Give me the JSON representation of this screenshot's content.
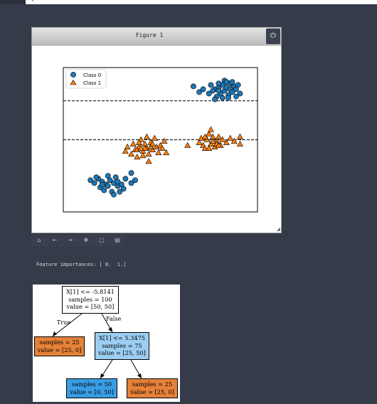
{
  "figure": {
    "title": "Figure 1",
    "power_icon": "⏻",
    "resize_icon": "◢"
  },
  "toolbar": {
    "buttons": [
      {
        "name": "home-icon",
        "glyph": "⌂"
      },
      {
        "name": "back-icon",
        "glyph": "←"
      },
      {
        "name": "forward-icon",
        "glyph": "→"
      },
      {
        "name": "pan-icon",
        "glyph": "✥"
      },
      {
        "name": "zoom-icon",
        "glyph": "▢"
      },
      {
        "name": "save-icon",
        "glyph": "▤"
      }
    ]
  },
  "output": {
    "text": "Feature importances: [ 0.  1.]"
  },
  "chart_data": {
    "type": "scatter",
    "title": "",
    "xlabel": "",
    "ylabel": "",
    "axes_ticks": "off",
    "xlim": [
      0,
      100
    ],
    "ylim": [
      0,
      100
    ],
    "grid": false,
    "legend": {
      "placement": "top-left",
      "entries": [
        "Class 0",
        "Class 1"
      ]
    },
    "series": [
      {
        "name": "Class 0",
        "marker": "circle",
        "color": "#1f77b4",
        "points": [
          [
            67,
            87
          ],
          [
            70,
            83
          ],
          [
            72,
            85
          ],
          [
            75,
            82
          ],
          [
            76,
            88
          ],
          [
            78,
            85
          ],
          [
            79,
            80
          ],
          [
            80,
            86
          ],
          [
            81,
            82
          ],
          [
            82,
            88
          ],
          [
            83,
            84
          ],
          [
            84,
            86
          ],
          [
            85,
            81
          ],
          [
            86,
            85
          ],
          [
            87,
            83
          ],
          [
            88,
            87
          ],
          [
            89,
            85
          ],
          [
            90,
            88
          ],
          [
            91,
            82
          ],
          [
            83,
            91
          ],
          [
            86,
            89
          ],
          [
            78,
            78
          ],
          [
            85,
            79
          ],
          [
            80,
            84
          ],
          [
            84,
            90
          ],
          [
            89,
            80
          ],
          [
            77,
            84
          ],
          [
            82,
            79
          ],
          [
            87,
            90
          ],
          [
            80,
            89
          ],
          [
            14,
            22
          ],
          [
            16,
            20
          ],
          [
            18,
            23
          ],
          [
            20,
            21
          ],
          [
            22,
            19
          ],
          [
            24,
            22
          ],
          [
            19,
            17
          ],
          [
            21,
            15
          ],
          [
            23,
            18
          ],
          [
            25,
            14
          ],
          [
            26,
            20
          ],
          [
            28,
            18
          ],
          [
            29,
            14
          ],
          [
            27,
            24
          ],
          [
            30,
            19
          ],
          [
            32,
            23
          ],
          [
            35,
            20
          ],
          [
            37,
            22
          ],
          [
            35,
            27
          ],
          [
            17,
            24
          ],
          [
            23,
            25
          ],
          [
            26,
            12
          ],
          [
            28,
            21
          ],
          [
            31,
            16
          ],
          [
            20,
            19
          ]
        ]
      },
      {
        "name": "Class 1",
        "marker": "triangle",
        "color": "#ff7f0e",
        "points": [
          [
            32,
            42
          ],
          [
            33,
            45
          ],
          [
            35,
            40
          ],
          [
            36,
            47
          ],
          [
            37,
            43
          ],
          [
            38,
            38
          ],
          [
            39,
            45
          ],
          [
            40,
            50
          ],
          [
            41,
            42
          ],
          [
            42,
            47
          ],
          [
            43,
            44
          ],
          [
            44,
            40
          ],
          [
            45,
            48
          ],
          [
            46,
            43
          ],
          [
            47,
            51
          ],
          [
            48,
            45
          ],
          [
            49,
            41
          ],
          [
            50,
            46
          ],
          [
            51,
            44
          ],
          [
            53,
            41
          ],
          [
            52,
            49
          ],
          [
            44,
            35
          ],
          [
            45,
            45
          ],
          [
            41,
            39
          ],
          [
            39,
            48
          ],
          [
            38,
            43
          ],
          [
            42,
            44
          ],
          [
            46,
            47
          ],
          [
            40,
            44
          ],
          [
            43,
            52
          ],
          [
            64,
            46
          ],
          [
            70,
            48
          ],
          [
            71,
            51
          ],
          [
            72,
            46
          ],
          [
            73,
            44
          ],
          [
            74,
            50
          ],
          [
            75,
            54
          ],
          [
            76,
            47
          ],
          [
            77,
            52
          ],
          [
            78,
            45
          ],
          [
            79,
            49
          ],
          [
            80,
            52
          ],
          [
            81,
            46
          ],
          [
            82,
            50
          ],
          [
            84,
            48
          ],
          [
            86,
            51
          ],
          [
            88,
            49
          ],
          [
            91,
            52
          ],
          [
            91,
            47
          ],
          [
            75,
            44
          ],
          [
            77,
            49
          ],
          [
            73,
            52
          ],
          [
            79,
            47
          ],
          [
            76,
            57
          ],
          [
            80,
            46
          ]
        ]
      }
    ],
    "hlines": [
      {
        "y": 77,
        "style": "dashed"
      },
      {
        "y": 50,
        "style": "dashed"
      }
    ]
  },
  "tree": {
    "root": {
      "line1": "X[1] <= -5.8141",
      "line2": "samples = 100",
      "line3": "value = [50, 50]",
      "color": "#ffffff"
    },
    "left_leaf": {
      "line1": "samples = 25",
      "line2": "value = [25, 0]",
      "color": "#e58139"
    },
    "right_node": {
      "line1": "X[1] <= 5.3475",
      "line2": "samples = 75",
      "line3": "value = [25, 50]",
      "color": "#9ccef2"
    },
    "rl_leaf": {
      "line1": "samples = 50",
      "line2": "value = [0, 50]",
      "color": "#399de5"
    },
    "rr_leaf": {
      "line1": "samples = 25",
      "line2": "value = [25, 0]",
      "color": "#e58139"
    },
    "true_label": "True",
    "false_label": "False"
  }
}
